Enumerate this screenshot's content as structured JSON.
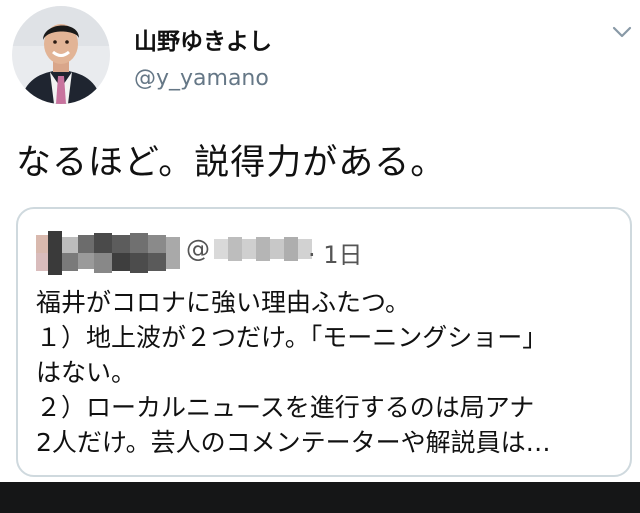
{
  "author": {
    "display_name": "山野ゆきよし",
    "handle": "@y_yamano",
    "avatar_icon": "profile-photo"
  },
  "menu_icon": "chevron-down-icon",
  "tweet": {
    "text": "なるほど。説得力がある。"
  },
  "quoted_tweet": {
    "handle_prefix": "@",
    "time": "· 1日",
    "lines": [
      "福井がコロナに強い理由ふたつ。",
      "１）地上波が２つだけ。「モーニングショー」",
      "はない。",
      "２）ローカルニュースを進行するのは局アナ",
      "2人だけ。芸人のコメンテーターや解説員は…"
    ]
  },
  "colors": {
    "secondary_text": "#657786",
    "quote_border": "#cfd9de",
    "bottom_bar": "#151617"
  }
}
